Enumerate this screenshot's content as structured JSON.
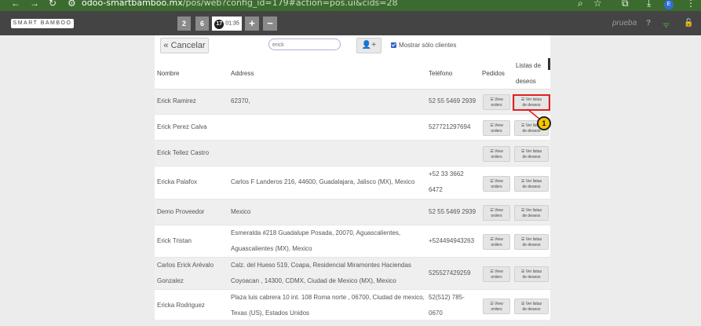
{
  "browser": {
    "url_host": "odoo-smartbamboo.mx",
    "url_path": "/pos/web?config_id=179#action=pos.ui&cids=28",
    "profile_initial": "E"
  },
  "pos": {
    "logo_text": "SMART BAMBOO",
    "orders": [
      "2",
      "6"
    ],
    "active_order_number": "17",
    "active_order_time": "01:35",
    "add_order_glyph": "+",
    "remove_order_glyph": "−",
    "user_name": "prueba",
    "help_glyph": "?"
  },
  "toolbar": {
    "cancel_label": "« Cancelar",
    "search_value": "erick",
    "add_client_glyph": "👤+",
    "only_clients_label": "Mostrar sólo clientes",
    "only_clients_checked": true
  },
  "table": {
    "headers": {
      "name": "Nombre",
      "address": "Address",
      "phone": "Teléfono",
      "orders": "Pedidos",
      "wishlists_line1": "Listas de",
      "wishlists_line2": "deseos"
    },
    "view_orders_line1": "☰ View",
    "view_orders_line2": "orders",
    "view_wishlist_line1": "☰ Ver listas",
    "view_wishlist_line2": "de deseos",
    "rows": [
      {
        "name1": "Erick Ramirez",
        "name2": "",
        "address1": "62370,",
        "address2": "",
        "phone1": "52 55 5469 2939",
        "phone2": ""
      },
      {
        "name1": "Erick Perez Calva",
        "name2": "",
        "address1": "",
        "address2": "",
        "phone1": "527721297694",
        "phone2": ""
      },
      {
        "name1": "Erick Tellez Castro",
        "name2": "",
        "address1": "",
        "address2": "",
        "phone1": "",
        "phone2": ""
      },
      {
        "name1": "Ericka Palafox",
        "name2": "",
        "address1": "Carlos F Landeros 216, 44600, Guadalajara, Jalisco (MX), Mexico",
        "address2": "",
        "phone1": "+52 33 3662",
        "phone2": "6472"
      },
      {
        "name1": "Demo Proveedor",
        "name2": "",
        "address1": "Mexico",
        "address2": "",
        "phone1": "52 55 5469 2939",
        "phone2": ""
      },
      {
        "name1": "Erick Tristan",
        "name2": "",
        "address1": "Esmeralda #218 Guadalupe Posada, 20070, Aguascalientes,",
        "address2": "Aguascalientes (MX), Mexico",
        "phone1": "+524494943263",
        "phone2": ""
      },
      {
        "name1": "Carlos Erick Arévalo",
        "name2": "Gonzalez",
        "address1": "Calz. del Hueso 519, Coapa, Residencial Miramontes Haciendas",
        "address2": "Coyoacan , 14300, CDMX, Ciudad de Mexico (MX), Mexico",
        "phone1": "525527429259",
        "phone2": ""
      },
      {
        "name1": "Ericka Rodriguez",
        "name2": "",
        "address1": "Plaza luis cabrera 10 int. 108 Roma norte , 06700, Ciudad de mexico,",
        "address2": "Texas (US), Estados Unidos",
        "phone1": "52(512) 785-",
        "phone2": "0670"
      }
    ]
  },
  "annotation": {
    "marker_number": "1"
  },
  "colors": {
    "pos_header": "#444444",
    "browser_bar": "#3c6b2f",
    "callout": "#e02020",
    "marker": "#f7c500"
  }
}
